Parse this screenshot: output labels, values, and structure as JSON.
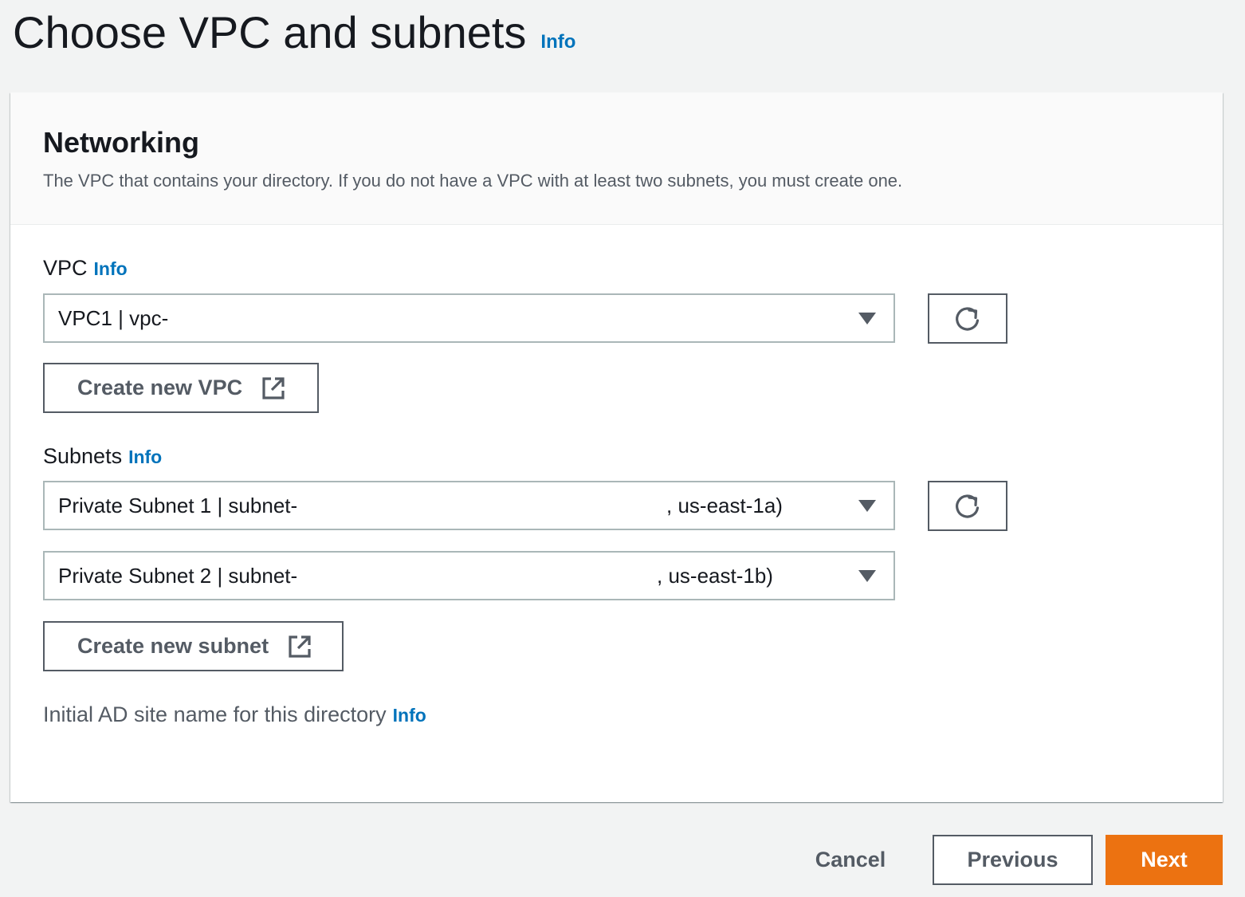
{
  "page": {
    "title": "Choose VPC and subnets",
    "info_label": "Info"
  },
  "networking": {
    "heading": "Networking",
    "description": "The VPC that contains your directory. If you do not have a VPC with at least two subnets, you must create one.",
    "vpc": {
      "label": "VPC",
      "info_label": "Info",
      "selected_value": "VPC1 | vpc-",
      "create_button_label": "Create new VPC"
    },
    "subnets": {
      "label": "Subnets",
      "info_label": "Info",
      "subnet1_value": "Private Subnet 1 | subnet-",
      "subnet1_suffix": ", us-east-1a)",
      "subnet2_value": "Private Subnet 2 | subnet-",
      "subnet2_suffix": ", us-east-1b)",
      "create_button_label": "Create new subnet"
    },
    "ad_site": {
      "label": "Initial AD site name for this directory",
      "info_label": "Info"
    }
  },
  "footer": {
    "cancel_label": "Cancel",
    "previous_label": "Previous",
    "next_label": "Next"
  },
  "colors": {
    "accent": "#ec7211",
    "link": "#0073bb",
    "background": "#f2f3f3"
  },
  "icons": {
    "refresh": "refresh-icon",
    "external_link": "external-link-icon",
    "caret": "caret-down-icon"
  }
}
